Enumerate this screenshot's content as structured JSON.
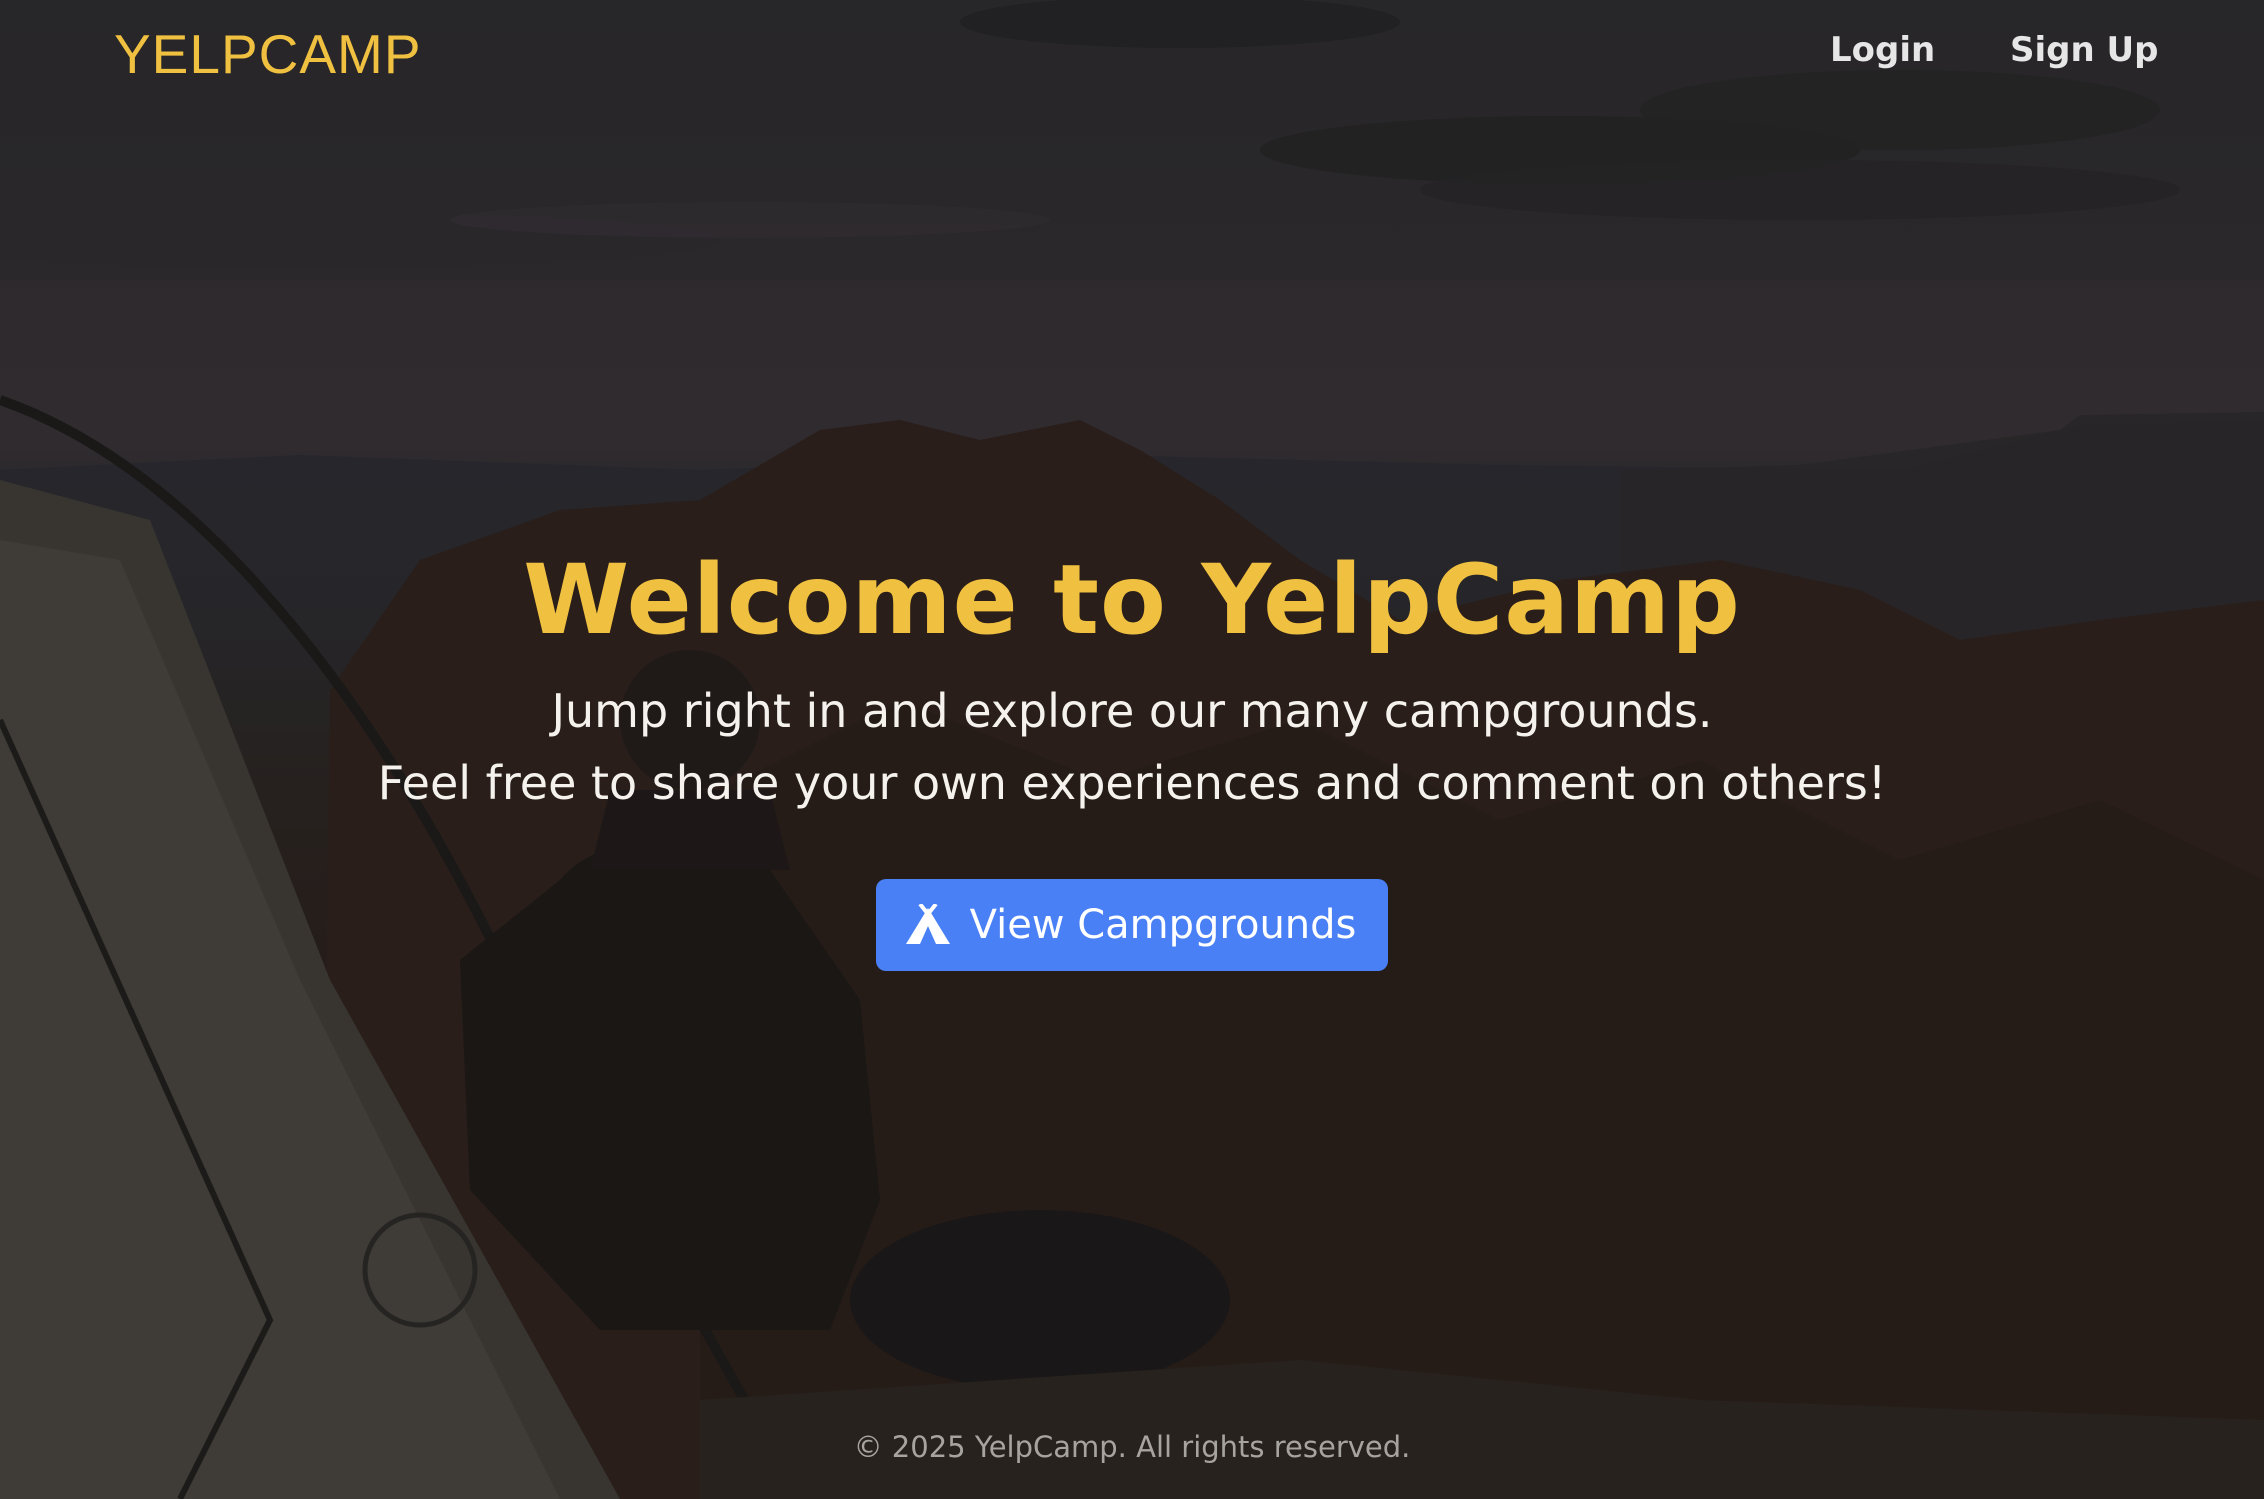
{
  "nav": {
    "brand": "YELPCAMP",
    "login_label": "Login",
    "signup_label": "Sign Up"
  },
  "hero": {
    "title": "Welcome to YelpCamp",
    "line1": "Jump right in and explore our many campgrounds.",
    "line2": "Feel free to share your own experiences and comment on others!",
    "cta_label": "View Campgrounds",
    "cta_icon": "tent-icon"
  },
  "footer": {
    "copyright": "© 2025 YelpCamp. All rights reserved."
  },
  "colors": {
    "accent": "#f0c040",
    "button": "#4a80f5",
    "text": "#f5f2ee",
    "muted": "#a7a39e"
  }
}
